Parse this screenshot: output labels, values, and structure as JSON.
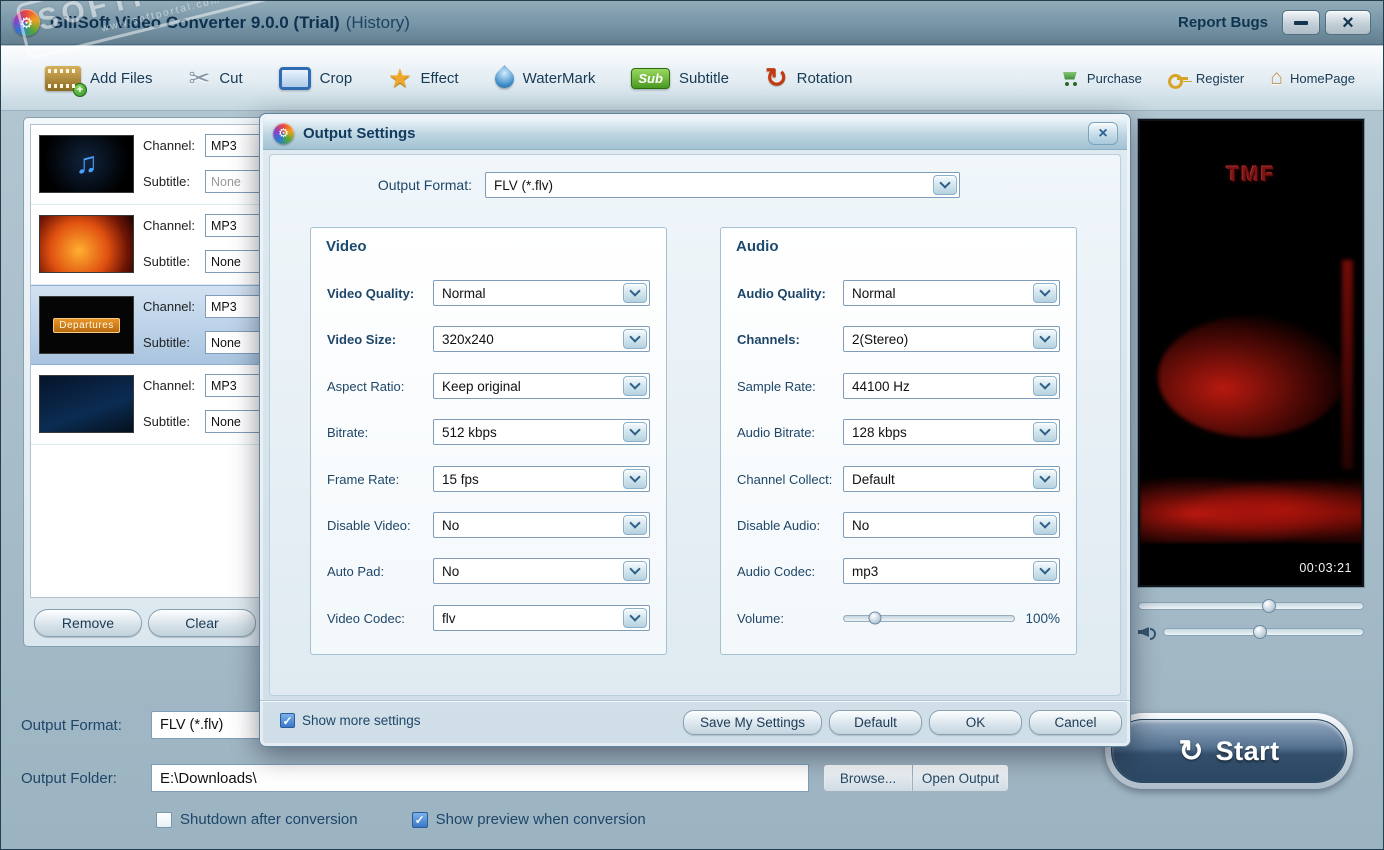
{
  "window": {
    "title": "GiliSoft Video Converter 9.0.0 (Trial)",
    "subtitle": "(History)",
    "report_bugs": "Report Bugs"
  },
  "icons": {
    "gear": "⚙",
    "cut": "✂",
    "effect": "★",
    "rotation": "↻",
    "homepage": "⌂",
    "music_note": "♫",
    "close": "×",
    "check": "✓",
    "start": "↻"
  },
  "toolbar": {
    "items": [
      {
        "label": "Add Files"
      },
      {
        "label": "Cut"
      },
      {
        "label": "Crop"
      },
      {
        "label": "Effect"
      },
      {
        "label": "WaterMark"
      },
      {
        "label": "Subtitle"
      },
      {
        "label": "Rotation"
      }
    ],
    "subtitle_badge": "Sub",
    "links": [
      {
        "label": "Purchase"
      },
      {
        "label": "Register"
      },
      {
        "label": "HomePage"
      }
    ]
  },
  "file_list": {
    "rows": [
      {
        "channel_label": "Channel:",
        "channel": "MP3",
        "subtitle_label": "Subtitle:",
        "subtitle": "None"
      },
      {
        "channel_label": "Channel:",
        "channel": "MP3",
        "subtitle_label": "Subtitle:",
        "subtitle": "None"
      },
      {
        "channel_label": "Channel:",
        "channel": "MP3",
        "subtitle_label": "Subtitle:",
        "subtitle": "None",
        "thumb_text": "Departures"
      },
      {
        "channel_label": "Channel:",
        "channel": "MP3",
        "subtitle_label": "Subtitle:",
        "subtitle": "None"
      }
    ],
    "remove_button": "Remove",
    "clear_button": "Clear"
  },
  "dialog": {
    "title": "Output Settings",
    "output_format": {
      "label": "Output Format:",
      "value": "FLV (*.flv)"
    },
    "video": {
      "title": "Video",
      "fields": [
        {
          "label": "Video Quality:",
          "value": "Normal"
        },
        {
          "label": "Video Size:",
          "value": "320x240"
        },
        {
          "label": "Aspect Ratio:",
          "value": "Keep original"
        },
        {
          "label": "Bitrate:",
          "value": "512 kbps"
        },
        {
          "label": "Frame Rate:",
          "value": "15 fps"
        },
        {
          "label": "Disable Video:",
          "value": "No"
        },
        {
          "label": "Auto Pad:",
          "value": "No"
        },
        {
          "label": "Video Codec:",
          "value": "flv"
        }
      ]
    },
    "audio": {
      "title": "Audio",
      "fields": [
        {
          "label": "Audio Quality:",
          "value": "Normal"
        },
        {
          "label": "Channels:",
          "value": "2(Stereo)"
        },
        {
          "label": "Sample Rate:",
          "value": "44100 Hz"
        },
        {
          "label": "Audio Bitrate:",
          "value": "128 kbps"
        },
        {
          "label": "Channel Collect:",
          "value": "Default"
        },
        {
          "label": "Disable Audio:",
          "value": "No"
        },
        {
          "label": "Audio Codec:",
          "value": "mp3"
        }
      ],
      "volume_label": "Volume:",
      "volume_value": "100%"
    },
    "show_more_label": "Show more settings",
    "buttons": {
      "save": "Save My Settings",
      "default": "Default",
      "ok": "OK",
      "cancel": "Cancel"
    }
  },
  "preview": {
    "logo": "TMF",
    "time": "00:03:21"
  },
  "output": {
    "format_label": "Output Format:",
    "format_value": "FLV (*.flv)",
    "folder_label": "Output Folder:",
    "folder_value": "E:\\Downloads\\",
    "browse_button": "Browse...",
    "open_output_button": "Open Output",
    "shutdown_label": "Shutdown after conversion",
    "preview_label": "Show preview when conversion",
    "start_button": "Start"
  },
  "watermark": {
    "line1": "SOFTPORTAL",
    "line2": "www.softportal.com"
  }
}
